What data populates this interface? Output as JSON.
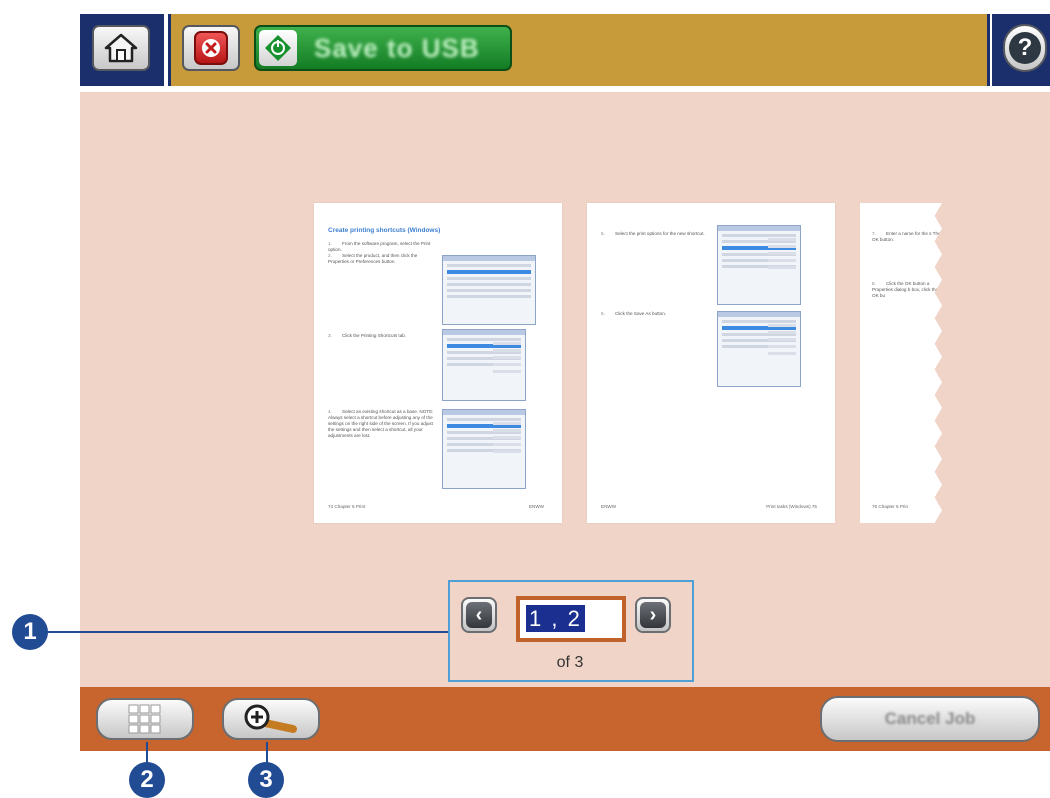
{
  "toolbar": {
    "primary_action_label": "Save to USB",
    "home_icon": "home-icon",
    "stop_icon": "stop-icon",
    "start_icon": "start-icon",
    "help_icon": "help-icon",
    "help_glyph": "?"
  },
  "preview": {
    "pages": [
      {
        "title": "Create printing shortcuts (Windows)",
        "steps": [
          {
            "num": "1.",
            "text": "From the software program, select the Print option."
          },
          {
            "num": "2.",
            "text": "Select the product, and then click the Properties or Preferences button."
          },
          {
            "num": "3.",
            "text": "Click the Printing Shortcuts tab."
          },
          {
            "num": "4.",
            "text": "Select an existing shortcut as a base. NOTE: Always select a shortcut before adjusting any of the settings on the right side of the screen. If you adjust the settings and then select a shortcut, all your adjustments are lost."
          }
        ],
        "footer_left": "74    Chapter 5  Print",
        "footer_right": "ENWW"
      },
      {
        "steps": [
          {
            "num": "5.",
            "text": "Select the print options for the new shortcut."
          },
          {
            "num": "6.",
            "text": "Click the Save As button."
          }
        ],
        "footer_left": "ENWW",
        "footer_right": "Print tasks (Windows)    75"
      },
      {
        "steps": [
          {
            "num": "7.",
            "text": "Enter a name for the s The OK button."
          },
          {
            "num": "8.",
            "text": "Click the OK button a Properties dialog b box, click the OK bu"
          }
        ],
        "footer_left": "76    Chapter 5  Prin"
      }
    ]
  },
  "pager": {
    "current_pages": "1 , 2",
    "of_label": "of 3",
    "prev_glyph": "‹",
    "next_glyph": "›"
  },
  "bottom": {
    "grid_icon": "grid-icon",
    "zoom_icon": "zoom-in-icon",
    "cancel_label": "Cancel Job"
  },
  "callouts": [
    "1",
    "2",
    "3"
  ],
  "colors": {
    "top_bar": "#c89b3a",
    "frame_blue": "#1a2f6b",
    "preview_bg": "#f0d4c8",
    "bottom_bar": "#c8642d",
    "highlight": "#4f9fd4",
    "callout": "#214b93"
  }
}
